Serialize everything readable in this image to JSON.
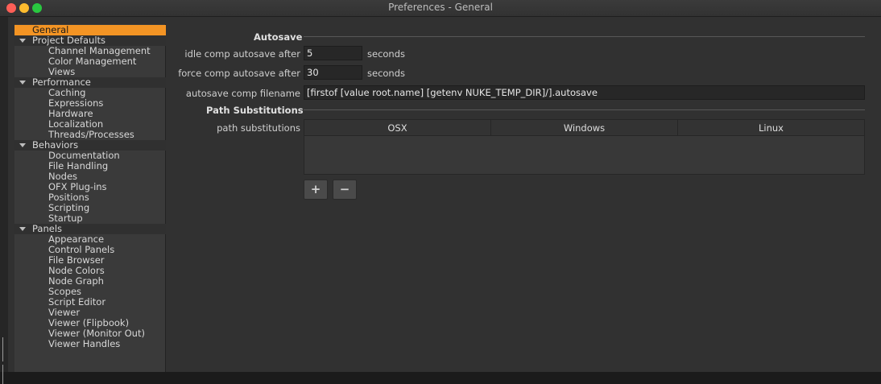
{
  "window": {
    "title": "Preferences - General"
  },
  "colors": {
    "accent": "#f39424",
    "panel": "#313131",
    "sidebar": "#3a3a3a"
  },
  "sidebar": {
    "items": [
      {
        "label": "General",
        "level": "top",
        "selected": true
      },
      {
        "label": "Project Defaults",
        "level": "group"
      },
      {
        "label": "Channel Management",
        "level": "child"
      },
      {
        "label": "Color Management",
        "level": "child"
      },
      {
        "label": "Views",
        "level": "child"
      },
      {
        "label": "Performance",
        "level": "group"
      },
      {
        "label": "Caching",
        "level": "child"
      },
      {
        "label": "Expressions",
        "level": "child"
      },
      {
        "label": "Hardware",
        "level": "child"
      },
      {
        "label": "Localization",
        "level": "child"
      },
      {
        "label": "Threads/Processes",
        "level": "child"
      },
      {
        "label": "Behaviors",
        "level": "group"
      },
      {
        "label": "Documentation",
        "level": "child"
      },
      {
        "label": "File Handling",
        "level": "child"
      },
      {
        "label": "Nodes",
        "level": "child"
      },
      {
        "label": "OFX Plug-ins",
        "level": "child"
      },
      {
        "label": "Positions",
        "level": "child"
      },
      {
        "label": "Scripting",
        "level": "child"
      },
      {
        "label": "Startup",
        "level": "child"
      },
      {
        "label": "Panels",
        "level": "group"
      },
      {
        "label": "Appearance",
        "level": "child"
      },
      {
        "label": "Control Panels",
        "level": "child"
      },
      {
        "label": "File Browser",
        "level": "child"
      },
      {
        "label": "Node Colors",
        "level": "child"
      },
      {
        "label": "Node Graph",
        "level": "child"
      },
      {
        "label": "Scopes",
        "level": "child"
      },
      {
        "label": "Script Editor",
        "level": "child"
      },
      {
        "label": "Viewer",
        "level": "child"
      },
      {
        "label": "Viewer (Flipbook)",
        "level": "child"
      },
      {
        "label": "Viewer (Monitor Out)",
        "level": "child"
      },
      {
        "label": "Viewer Handles",
        "level": "child"
      }
    ]
  },
  "autosave": {
    "section_label": "Autosave",
    "idle_label": "idle comp autosave after",
    "idle_value": "5",
    "force_label": "force comp autosave after",
    "force_value": "30",
    "unit": "seconds",
    "filename_label": "autosave comp filename",
    "filename_value": "[firstof [value root.name] [getenv NUKE_TEMP_DIR]/].autosave"
  },
  "path_substitutions": {
    "section_label": "Path Substitutions",
    "field_label": "path substitutions",
    "columns": [
      "OSX",
      "Windows",
      "Linux"
    ],
    "add_button": "+",
    "remove_button": "−"
  }
}
